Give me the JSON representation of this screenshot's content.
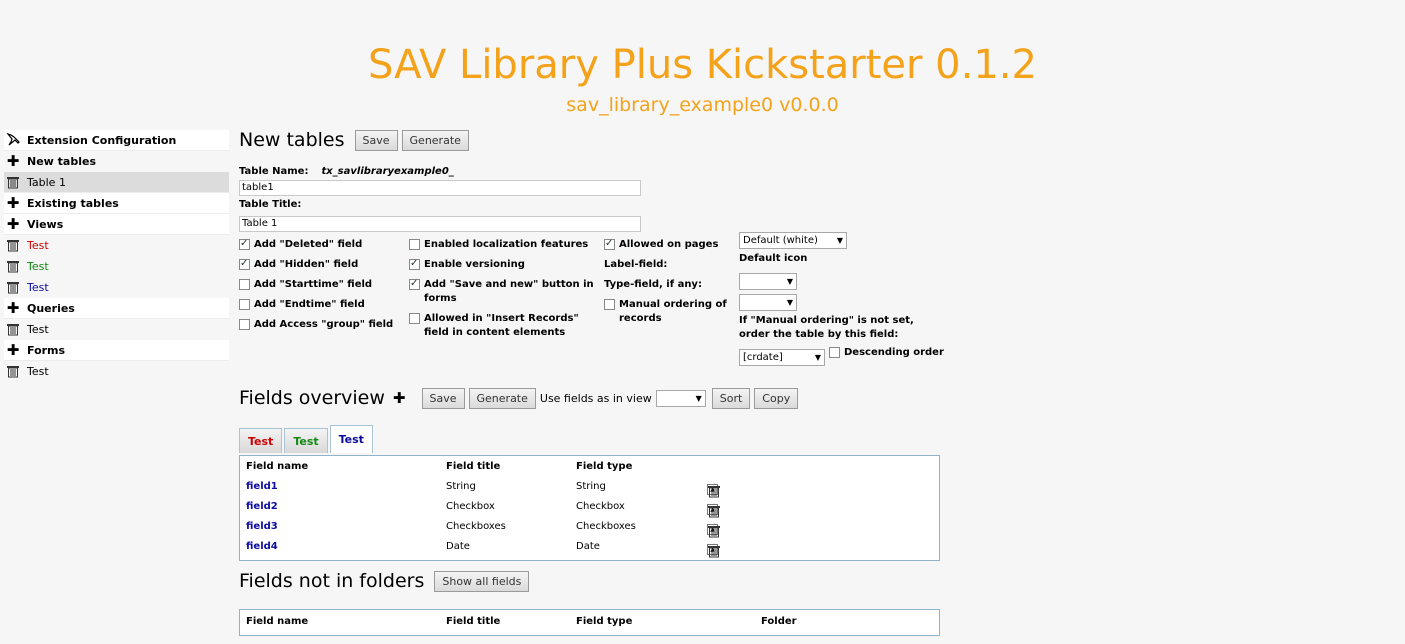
{
  "header": {
    "title": "SAV Library Plus Kickstarter 0.1.2",
    "subtitle": "sav_library_example0 v0.0.0"
  },
  "sidebar": {
    "items": [
      {
        "label": "Extension Configuration",
        "icon": "pen-icon",
        "style": "bold"
      },
      {
        "label": "New tables",
        "icon": "plus-icon",
        "style": "bold"
      },
      {
        "label": "Table 1",
        "icon": "trash-icon",
        "style": "selected"
      },
      {
        "label": "Existing tables",
        "icon": "plus-icon",
        "style": "bold"
      },
      {
        "label": "Views",
        "icon": "plus-icon",
        "style": "bold"
      },
      {
        "label": "Test",
        "icon": "trash-icon",
        "color": "#cc0000"
      },
      {
        "label": "Test",
        "icon": "trash-icon",
        "color": "#118811"
      },
      {
        "label": "Test",
        "icon": "trash-icon",
        "color": "#0b0b9e"
      },
      {
        "label": "Queries",
        "icon": "plus-icon",
        "style": "bold"
      },
      {
        "label": "Test",
        "icon": "trash-icon"
      },
      {
        "label": "Forms",
        "icon": "plus-icon",
        "style": "bold"
      },
      {
        "label": "Test",
        "icon": "trash-icon"
      }
    ]
  },
  "new_tables": {
    "heading": "New tables",
    "save_label": "Save",
    "generate_label": "Generate",
    "table_name_label": "Table Name:",
    "table_name_prefix": "tx_savlibraryexample0_",
    "table_name_value": "table1",
    "table_title_label": "Table Title:",
    "table_title_value": "Table 1",
    "options": {
      "add_deleted": "Add \"Deleted\" field",
      "add_hidden": "Add \"Hidden\" field",
      "add_starttime": "Add \"Starttime\" field",
      "add_endtime": "Add \"Endtime\" field",
      "add_access_group": "Add Access \"group\" field",
      "enable_localization": "Enabled localization features",
      "enable_versioning": "Enable versioning",
      "save_and_new_1": "Add \"Save and new\" button in",
      "save_and_new_2": "forms",
      "insert_records_1": "Allowed in \"Insert Records\"",
      "insert_records_2": "field in content elements",
      "allowed_on_pages": "Allowed on pages",
      "label_field": "Label-field:",
      "type_field": "Type-field, if any:",
      "manual_ordering_1": "Manual ordering of",
      "manual_ordering_2": "records",
      "default_color": "Default (white)",
      "default_icon": "Default icon",
      "ordering_note_1": "If \"Manual ordering\" is not set,",
      "ordering_note_2": "order the table by this field:",
      "order_field_value": "[crdate]",
      "descending_order": "Descending order"
    },
    "checked": {
      "add_deleted": true,
      "add_hidden": true,
      "add_starttime": false,
      "add_endtime": false,
      "add_access_group": false,
      "enable_localization": false,
      "enable_versioning": true,
      "save_and_new": true,
      "insert_records": false,
      "allowed_on_pages": true,
      "manual_ordering": false,
      "descending_order": false
    }
  },
  "fields_overview": {
    "heading": "Fields overview",
    "save_label": "Save",
    "generate_label": "Generate",
    "use_fields_label": "Use fields as in view",
    "sort_label": "Sort",
    "copy_label": "Copy",
    "tabs": [
      {
        "label": "Test",
        "color": "#cc0000"
      },
      {
        "label": "Test",
        "color": "#118811"
      },
      {
        "label": "Test",
        "color": "#0b0b9e"
      }
    ],
    "columns": {
      "name": "Field name",
      "title": "Field title",
      "type": "Field type"
    },
    "rows": [
      {
        "name": "field1",
        "title": "String",
        "type": "String"
      },
      {
        "name": "field2",
        "title": "Checkbox",
        "type": "Checkbox"
      },
      {
        "name": "field3",
        "title": "Checkboxes",
        "type": "Checkboxes"
      },
      {
        "name": "field4",
        "title": "Date",
        "type": "Date"
      }
    ]
  },
  "fields_not_in_folders": {
    "heading": "Fields not in folders",
    "show_all_label": "Show all fields",
    "columns": {
      "name": "Field name",
      "title": "Field title",
      "type": "Field type",
      "folder": "Folder"
    }
  }
}
